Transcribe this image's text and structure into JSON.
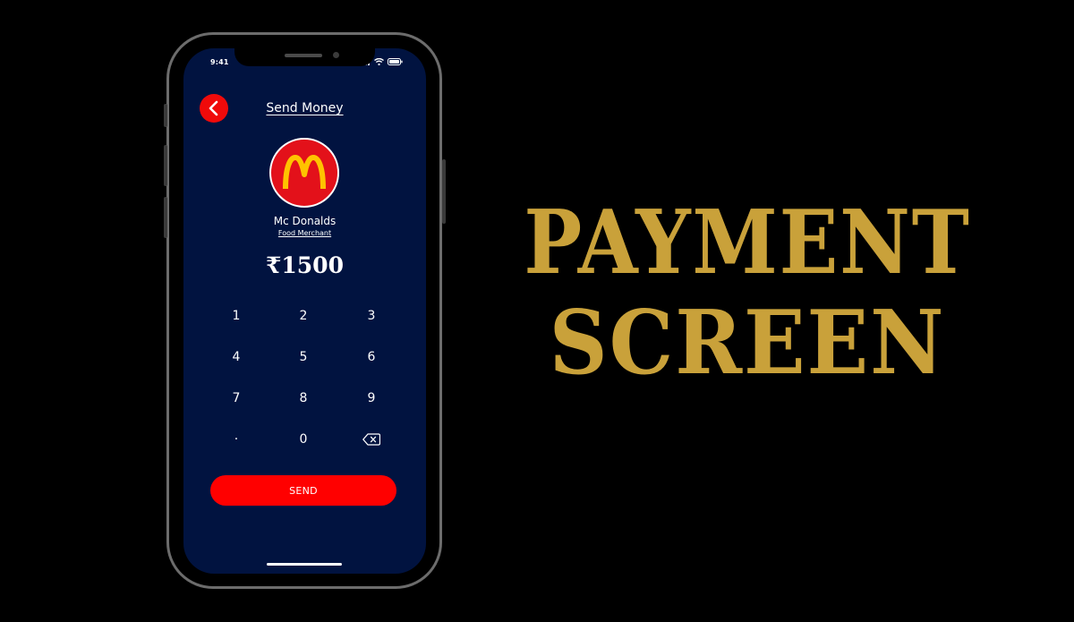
{
  "status_bar": {
    "time": "9:41"
  },
  "header": {
    "title": "Send Money"
  },
  "merchant": {
    "name": "Mc Donalds",
    "category": "Food Merchant",
    "logo_letter": "M"
  },
  "payment": {
    "amount": "₹1500"
  },
  "keypad": {
    "keys": [
      "1",
      "2",
      "3",
      "4",
      "5",
      "6",
      "7",
      "8",
      "9",
      "·",
      "0"
    ]
  },
  "actions": {
    "send_label": "SEND"
  },
  "headline": {
    "line1": "PAYMENT",
    "line2": "SCREEN"
  },
  "colors": {
    "background": "#000000",
    "screen": "#011340",
    "accent_red": "#ff0000",
    "logo_yellow": "#ffc300",
    "headline_gold": "#c9a13a"
  }
}
